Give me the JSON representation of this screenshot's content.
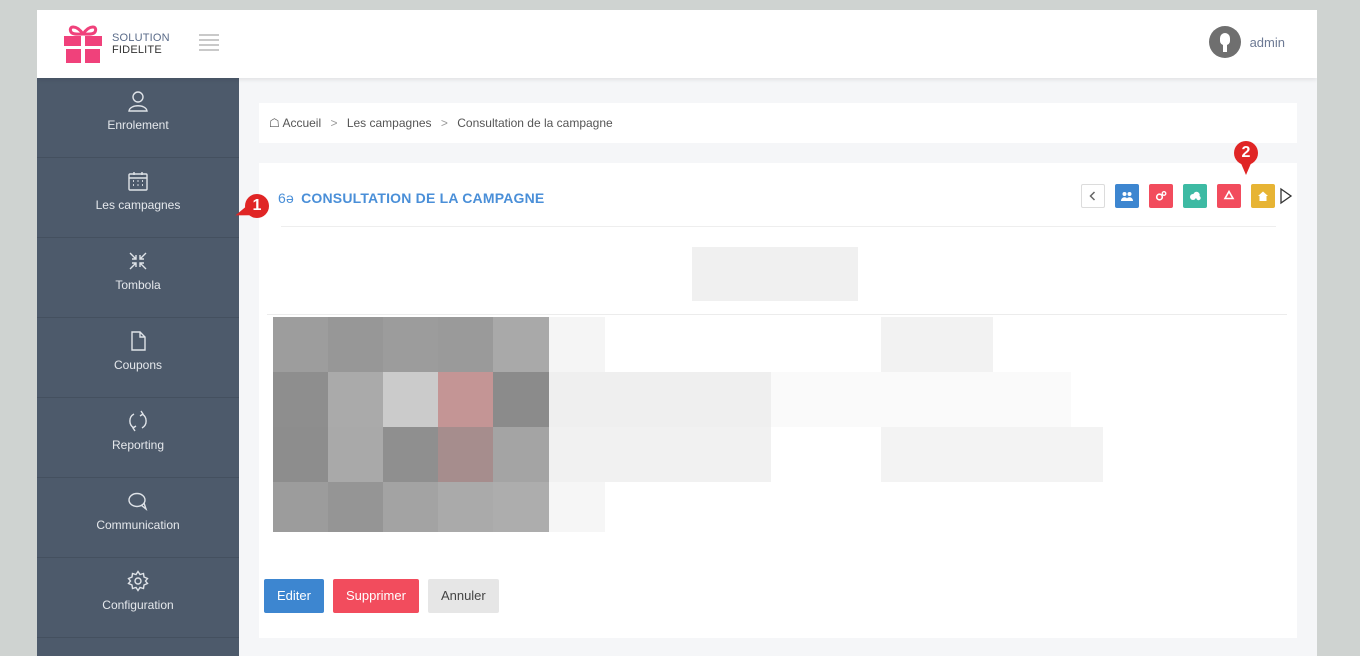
{
  "header": {
    "logo_line1": "SOLUTION",
    "logo_line2": "FIDELITE",
    "user_name": "admin"
  },
  "sidebar": {
    "items": [
      {
        "label": "Enrolement",
        "icon": "user-icon"
      },
      {
        "label": "Les campagnes",
        "icon": "calendar-icon"
      },
      {
        "label": "Tombola",
        "icon": "compress-arrows-icon"
      },
      {
        "label": "Coupons",
        "icon": "document-icon"
      },
      {
        "label": "Reporting",
        "icon": "refresh-icon"
      },
      {
        "label": "Communication",
        "icon": "chat-icon"
      },
      {
        "label": "Configuration",
        "icon": "gear-icon"
      }
    ]
  },
  "breadcrumb": {
    "home": "Accueil",
    "level2": "Les campagnes",
    "current": "Consultation de la campagne"
  },
  "card": {
    "title_icon": "6ə",
    "title": "CONSULTATION DE LA CAMPAGNE"
  },
  "toolbar": {
    "buttons": [
      {
        "name": "back-button",
        "icon": "chevron-left-icon",
        "color": "#ffffff"
      },
      {
        "name": "users-button",
        "icon": "users-icon",
        "color": "#3d86d0"
      },
      {
        "name": "settings-button",
        "icon": "cogs-icon",
        "color": "#f24c5d"
      },
      {
        "name": "cloud-button",
        "icon": "cloud-icon",
        "color": "#3dbaa3"
      },
      {
        "name": "recycle-button",
        "icon": "recycle-icon",
        "color": "#f24c5d"
      },
      {
        "name": "home-button",
        "icon": "home-icon",
        "color": "#e7b434"
      }
    ]
  },
  "annotations": {
    "badge1": "1",
    "badge2": "2"
  },
  "actions": {
    "edit": "Editer",
    "delete": "Supprimer",
    "cancel": "Annuler"
  },
  "colors": {
    "primary": "#3d86d0",
    "danger": "#f24c5d",
    "success": "#3dbaa3",
    "warning": "#e7b434",
    "sidebar": "#4d5a6b",
    "badge": "#e02525"
  }
}
